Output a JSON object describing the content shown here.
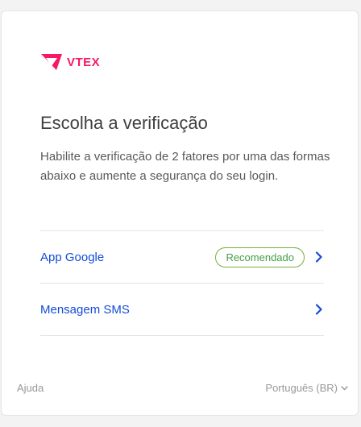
{
  "brand": {
    "name": "VTEX",
    "color": "#f71963"
  },
  "heading": "Escolha a verificação",
  "description": "Habilite a verificação de 2 fatores por uma das formas abaixo e aumente a segurança do seu login.",
  "options": [
    {
      "label": "App Google",
      "badge": "Recomendado",
      "icon": "chevron-right-icon"
    },
    {
      "label": "Mensagem SMS",
      "icon": "chevron-right-icon"
    }
  ],
  "footer": {
    "help": "Ajuda",
    "language": "Português (BR)",
    "language_icon": "chevron-down-icon"
  },
  "colors": {
    "link": "#134cd8",
    "badge": "#43a047"
  }
}
